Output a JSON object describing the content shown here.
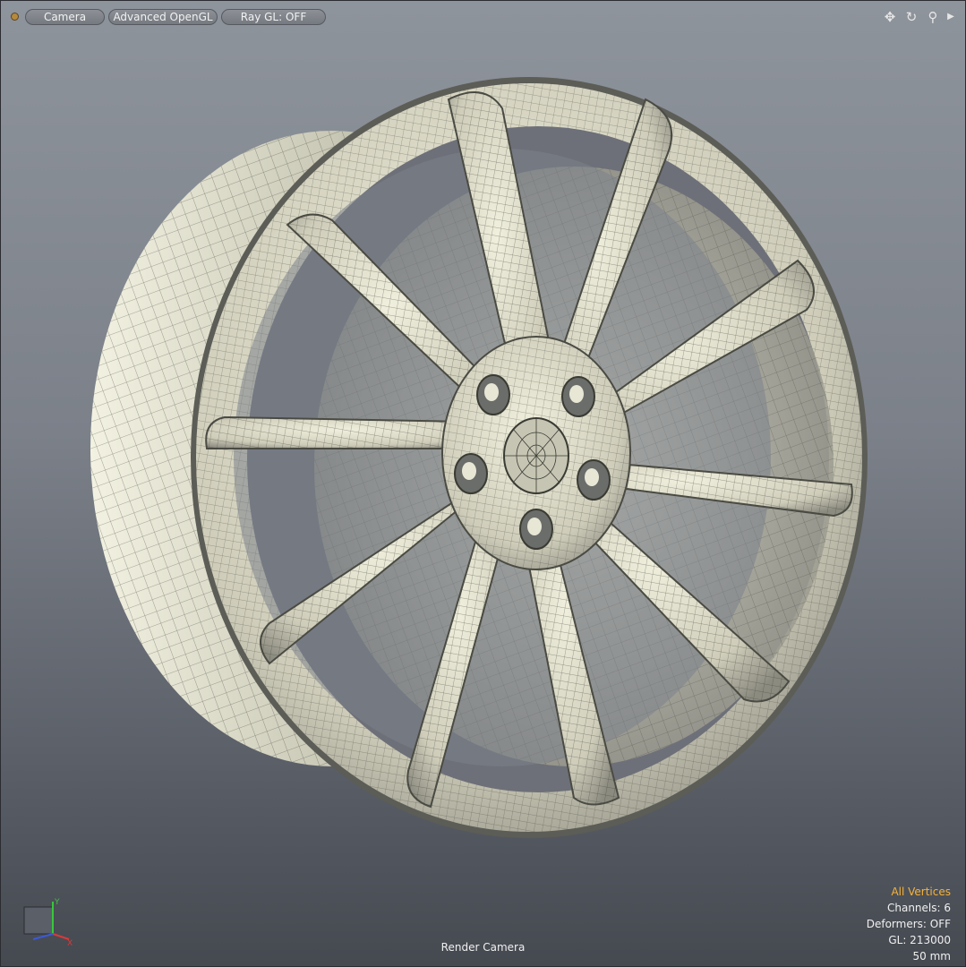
{
  "toolbar": {
    "camera_label": "Camera",
    "opengl_label": "Advanced OpenGL",
    "raygl_label": "Ray GL: OFF"
  },
  "tool_icons": [
    "move-icon",
    "rotate-icon",
    "zoom-icon",
    "expand-arrow-icon"
  ],
  "viewport": {
    "camera_name": "Render Camera"
  },
  "axis": {
    "y_label": "Y",
    "x_label": "X"
  },
  "info": {
    "selection_mode": "All Vertices",
    "channels": "Channels: 6",
    "deformers": "Deformers: OFF",
    "gl": "GL: 213000",
    "focal_length": "50 mm"
  },
  "colors": {
    "selection_accent": "#f5b23a",
    "mesh_surface": "#e9e8d5",
    "wire": "#3a3b33"
  }
}
